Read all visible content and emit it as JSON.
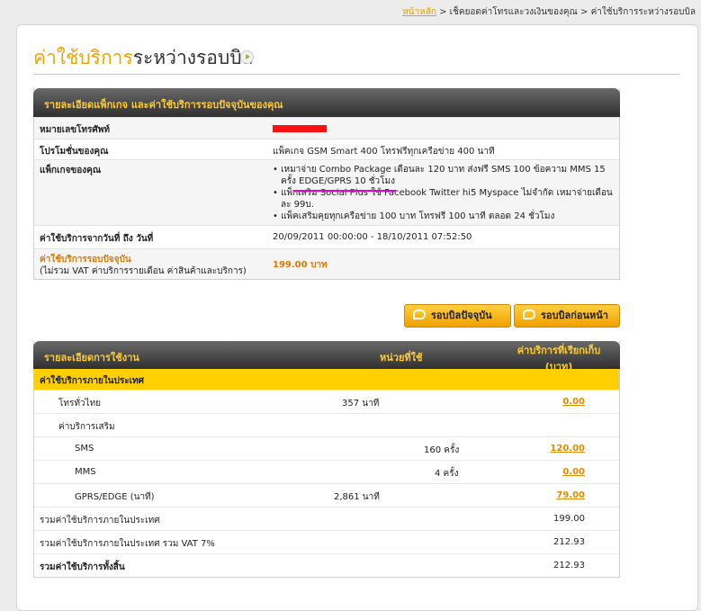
{
  "breadcrumb": {
    "home": "หน้าหลัก",
    "sep": ">",
    "section": "เช็คยอดค่าโทรและวงเงินของคุณ",
    "current": "ค่าใช้บริการระหว่างรอบบิล"
  },
  "page_title": {
    "orange": "ค่าใช้บริการ",
    "dark": "ระหว่างรอบบิล"
  },
  "package_box": {
    "header": "รายละเอียดแพ็กเกจ และค่าใช้บริการรอบปัจจุบันของคุณ",
    "rows": {
      "phone_label": "หมายเลขโทรศัพท์",
      "promo_label": "โปรโมชั่นของคุณ",
      "promo_value": "แพ็คเกจ GSM Smart 400 โทรฟรีทุกเครือข่าย 400 นาที",
      "packages_label": "แพ็กเกจของคุณ",
      "packages": [
        "• เหมาจ่าย Combo Package เดือนละ 120 บาท ส่งฟรี SMS 100 ข้อความ MMS 15 ครั้ง EDGE/GPRS 10 ชั่วโมง",
        "• แพ็กเสริม Social Plus ใช้ Facebook Twitter hi5 Myspace ไม่จำกัด เหมาจ่ายเดือนละ 99บ.",
        "• แพ็คเสริมคุยทุกเครือข่าย 100 บาท โทรฟรี 100 นาที ตลอด 24 ชั่วโมง"
      ],
      "period_label": "ค่าใช้บริการจากวันที่ ถึง วันที่",
      "period_value": "20/09/2011 00:00:00 - 18/10/2011 07:52:50",
      "current_label": "ค่าใช้บริการรอบปัจจุบัน",
      "current_sub": "(ไม่รวม VAT ค่าบริการรายเดือน ค่าสินค้าและบริการ)",
      "current_value": "199.00 บาท"
    }
  },
  "buttons": {
    "current_bill": "รอบบิลปัจจุบัน",
    "previous_bill": "รอบบิลก่อนหน้า"
  },
  "usage_box": {
    "headers": {
      "detail": "รายละเอียดการใช้งาน",
      "unit": "หน่วยที่ใช้",
      "charge_line1": "ค่าบริการที่เรียกเก็บ",
      "charge_line2": "(บาท)"
    },
    "category": "ค่าใช้บริการภายในประเทศ",
    "voice_label": "โทรทั่วไทย",
    "voice_units": "357 นาที",
    "voice_charge": "0.00",
    "extra_label": "ค่าบริการเสริม",
    "sms_label": "SMS",
    "sms_units": "160 ครั้ง",
    "sms_charge": "120.00",
    "mms_label": "MMS",
    "mms_units": "4 ครั้ง",
    "mms_charge": "0.00",
    "gprs_label": "GPRS/EDGE (นาที)",
    "gprs_units": "2,861 นาที",
    "gprs_charge": "79.00",
    "total_domestic_label": "รวมค่าใช้บริการภายในประเทศ",
    "total_domestic": "199.00",
    "total_vat_label": "รวมค่าใช้บริการภายในประเทศ รวม VAT 7%",
    "total_vat": "212.93",
    "grand_total_label": "รวมค่าใช้บริการทั้งสิ้น",
    "grand_total": "212.93"
  },
  "colors": {
    "accent": "#f0a400",
    "header_bg": "#3a3a3a",
    "header_text": "#ffcc33",
    "category_bg": "#ffd000",
    "highlight": "#e000d8",
    "redaction": "#ff1010"
  }
}
